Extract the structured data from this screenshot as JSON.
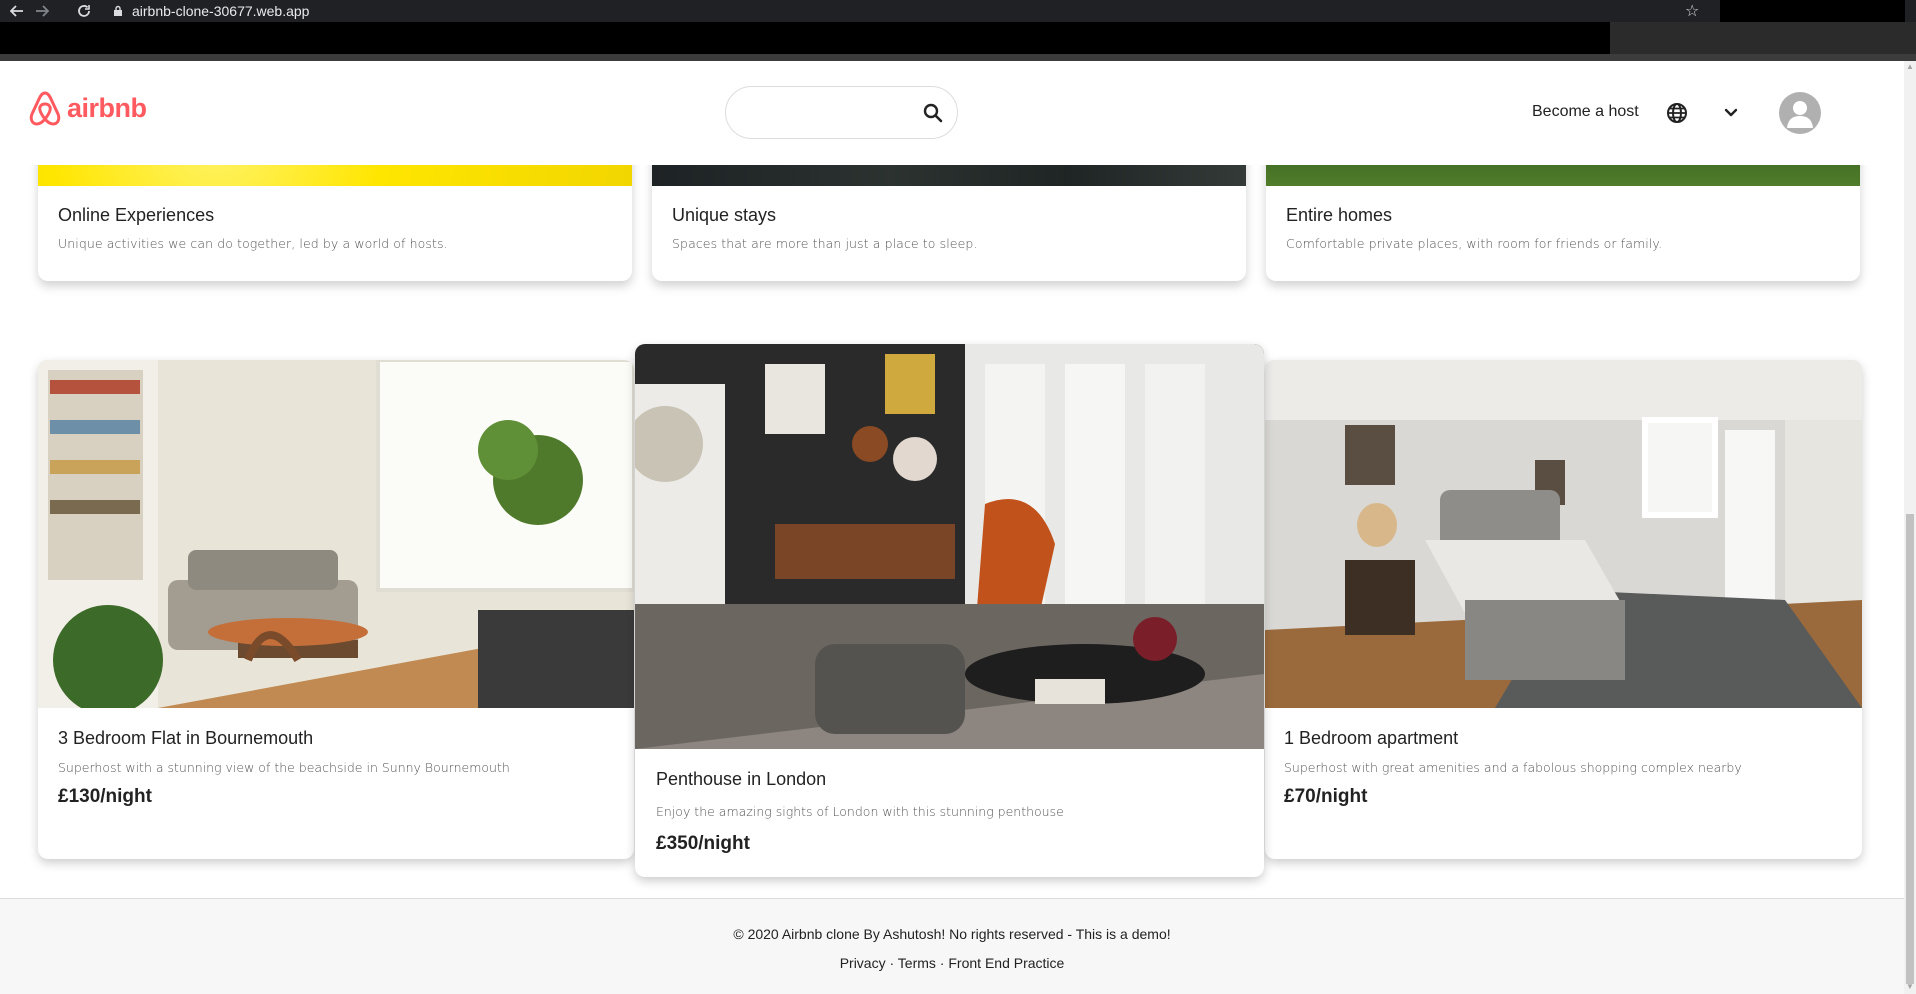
{
  "browser": {
    "url": "airbnb-clone-30677.web.app",
    "icons": [
      "back-arrow-icon",
      "forward-arrow-icon",
      "reload-icon",
      "lock-icon",
      "star-icon"
    ]
  },
  "header": {
    "logo_text": "airbnb",
    "search_placeholder": "",
    "become_host": "Become a host",
    "icons": [
      "airbnb-logo-icon",
      "search-icon",
      "globe-icon",
      "chevron-down-icon",
      "avatar-icon"
    ]
  },
  "categories": [
    {
      "title": "Online Experiences",
      "description": "Unique activities we can do together, led by a world of hosts."
    },
    {
      "title": "Unique stays",
      "description": "Spaces that are more than just a place to sleep."
    },
    {
      "title": "Entire homes",
      "description": "Comfortable private places, with room for friends or family."
    }
  ],
  "listings": [
    {
      "name": "3 Bedroom Flat in Bournemouth",
      "description": "Superhost with a stunning view of the beachside in Sunny Bournemouth",
      "price": "£130/night"
    },
    {
      "name": "Penthouse in London",
      "description": "Enjoy the amazing sights of London with this stunning penthouse",
      "price": "£350/night"
    },
    {
      "name": "1 Bedroom apartment",
      "description": "Superhost with great amenities and a fabolous shopping complex nearby",
      "price": "£70/night"
    }
  ],
  "footer": {
    "copyright": "© 2020 Airbnb clone By Ashutosh! No rights reserved - This is a demo!",
    "links": [
      "Privacy",
      "Terms",
      "Front End Practice"
    ],
    "separator": " · "
  },
  "colors": {
    "brand": "#ff5a5f",
    "text": "#222222",
    "muted": "#555555",
    "footer_bg": "#f7f7f7"
  }
}
